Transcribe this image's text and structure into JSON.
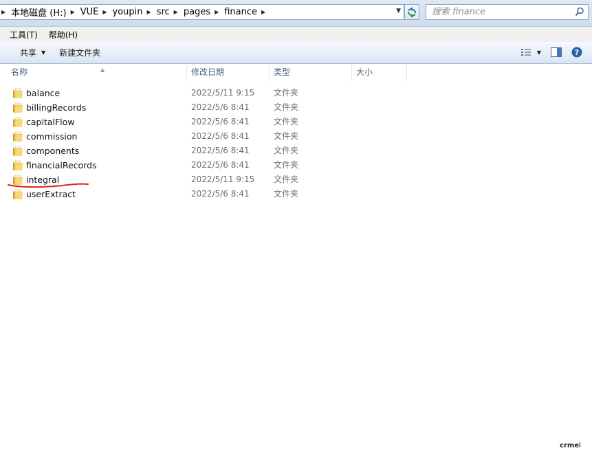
{
  "address": {
    "crumbs": [
      "本地磁盘 (H:)",
      "VUE",
      "youpin",
      "src",
      "pages",
      "finance"
    ],
    "search_placeholder": "搜索 finance"
  },
  "menu": [
    "工具(T)",
    "帮助(H)"
  ],
  "toolbar": {
    "share_label": "共享",
    "new_folder_label": "新建文件夹"
  },
  "columns": {
    "name": "名称",
    "date": "修改日期",
    "type": "类型",
    "size": "大小"
  },
  "files": [
    {
      "name": "balance",
      "date": "2022/5/11 9:15",
      "type": "文件夹"
    },
    {
      "name": "billingRecords",
      "date": "2022/5/6 8:41",
      "type": "文件夹"
    },
    {
      "name": "capitalFlow",
      "date": "2022/5/6 8:41",
      "type": "文件夹"
    },
    {
      "name": "commission",
      "date": "2022/5/6 8:41",
      "type": "文件夹"
    },
    {
      "name": "components",
      "date": "2022/5/6 8:41",
      "type": "文件夹"
    },
    {
      "name": "financialRecords",
      "date": "2022/5/6 8:41",
      "type": "文件夹"
    },
    {
      "name": "integral",
      "date": "2022/5/11 9:15",
      "type": "文件夹"
    },
    {
      "name": "userExtract",
      "date": "2022/5/6 8:41",
      "type": "文件夹"
    }
  ],
  "annotation_color": "#e02020",
  "watermark_text": "crmeb"
}
